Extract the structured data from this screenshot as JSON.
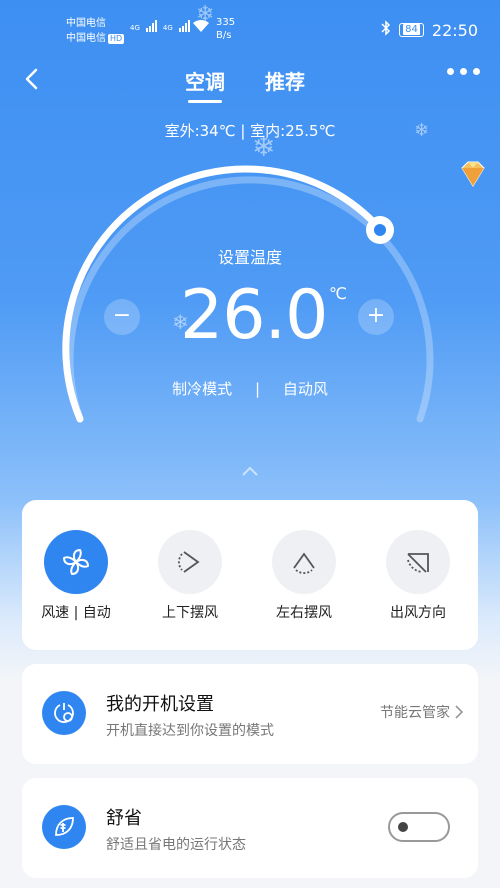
{
  "status_bar": {
    "carrier1": "中国电信",
    "carrier2": "中国电信",
    "hd": "HD",
    "net1": "4G",
    "net2": "4G",
    "speed_value": "335",
    "speed_unit": "B/s",
    "battery": "84",
    "time": "22:50"
  },
  "header": {
    "tabs": [
      {
        "label": "空调",
        "active": true
      },
      {
        "label": "推荐",
        "active": false
      }
    ]
  },
  "temp_info": "室外:34℃ | 室内:25.5℃",
  "dial": {
    "set_label": "设置温度",
    "temperature": "26.0",
    "unit": "℃",
    "minus": "−",
    "plus": "+",
    "mode": "制冷模式",
    "separator": "|",
    "fan": "自动风"
  },
  "controls": [
    {
      "label": "风速 | 自动",
      "icon": "fan-icon",
      "active": true
    },
    {
      "label": "上下摆风",
      "icon": "vertical-swing-icon",
      "active": false
    },
    {
      "label": "左右摆风",
      "icon": "horizontal-swing-icon",
      "active": false
    },
    {
      "label": "出风方向",
      "icon": "wind-direction-icon",
      "active": false
    }
  ],
  "settings": [
    {
      "title": "我的开机设置",
      "subtitle": "开机直接达到你设置的模式",
      "link": "节能云管家"
    },
    {
      "title": "舒省",
      "subtitle": "舒适且省电的运行状态",
      "toggle_on": false
    }
  ],
  "colors": {
    "accent": "#2f86f0",
    "header_blue": "#3d8ff2",
    "background": "#f3f5f8"
  }
}
